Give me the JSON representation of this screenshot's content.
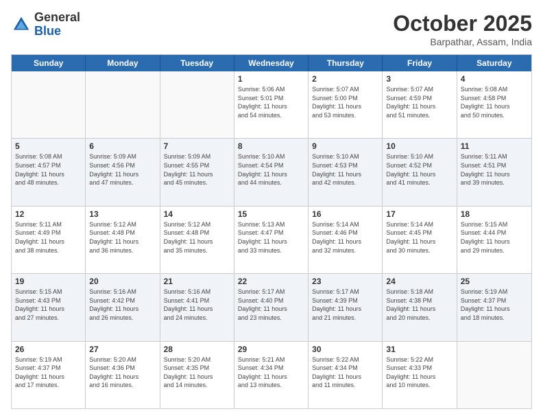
{
  "header": {
    "logo_general": "General",
    "logo_blue": "Blue",
    "month": "October 2025",
    "location": "Barpathar, Assam, India"
  },
  "weekdays": [
    "Sunday",
    "Monday",
    "Tuesday",
    "Wednesday",
    "Thursday",
    "Friday",
    "Saturday"
  ],
  "rows": [
    {
      "alt": false,
      "cells": [
        {
          "day": "",
          "info": ""
        },
        {
          "day": "",
          "info": ""
        },
        {
          "day": "",
          "info": ""
        },
        {
          "day": "1",
          "info": "Sunrise: 5:06 AM\nSunset: 5:01 PM\nDaylight: 11 hours\nand 54 minutes."
        },
        {
          "day": "2",
          "info": "Sunrise: 5:07 AM\nSunset: 5:00 PM\nDaylight: 11 hours\nand 53 minutes."
        },
        {
          "day": "3",
          "info": "Sunrise: 5:07 AM\nSunset: 4:59 PM\nDaylight: 11 hours\nand 51 minutes."
        },
        {
          "day": "4",
          "info": "Sunrise: 5:08 AM\nSunset: 4:58 PM\nDaylight: 11 hours\nand 50 minutes."
        }
      ]
    },
    {
      "alt": true,
      "cells": [
        {
          "day": "5",
          "info": "Sunrise: 5:08 AM\nSunset: 4:57 PM\nDaylight: 11 hours\nand 48 minutes."
        },
        {
          "day": "6",
          "info": "Sunrise: 5:09 AM\nSunset: 4:56 PM\nDaylight: 11 hours\nand 47 minutes."
        },
        {
          "day": "7",
          "info": "Sunrise: 5:09 AM\nSunset: 4:55 PM\nDaylight: 11 hours\nand 45 minutes."
        },
        {
          "day": "8",
          "info": "Sunrise: 5:10 AM\nSunset: 4:54 PM\nDaylight: 11 hours\nand 44 minutes."
        },
        {
          "day": "9",
          "info": "Sunrise: 5:10 AM\nSunset: 4:53 PM\nDaylight: 11 hours\nand 42 minutes."
        },
        {
          "day": "10",
          "info": "Sunrise: 5:10 AM\nSunset: 4:52 PM\nDaylight: 11 hours\nand 41 minutes."
        },
        {
          "day": "11",
          "info": "Sunrise: 5:11 AM\nSunset: 4:51 PM\nDaylight: 11 hours\nand 39 minutes."
        }
      ]
    },
    {
      "alt": false,
      "cells": [
        {
          "day": "12",
          "info": "Sunrise: 5:11 AM\nSunset: 4:49 PM\nDaylight: 11 hours\nand 38 minutes."
        },
        {
          "day": "13",
          "info": "Sunrise: 5:12 AM\nSunset: 4:48 PM\nDaylight: 11 hours\nand 36 minutes."
        },
        {
          "day": "14",
          "info": "Sunrise: 5:12 AM\nSunset: 4:48 PM\nDaylight: 11 hours\nand 35 minutes."
        },
        {
          "day": "15",
          "info": "Sunrise: 5:13 AM\nSunset: 4:47 PM\nDaylight: 11 hours\nand 33 minutes."
        },
        {
          "day": "16",
          "info": "Sunrise: 5:14 AM\nSunset: 4:46 PM\nDaylight: 11 hours\nand 32 minutes."
        },
        {
          "day": "17",
          "info": "Sunrise: 5:14 AM\nSunset: 4:45 PM\nDaylight: 11 hours\nand 30 minutes."
        },
        {
          "day": "18",
          "info": "Sunrise: 5:15 AM\nSunset: 4:44 PM\nDaylight: 11 hours\nand 29 minutes."
        }
      ]
    },
    {
      "alt": true,
      "cells": [
        {
          "day": "19",
          "info": "Sunrise: 5:15 AM\nSunset: 4:43 PM\nDaylight: 11 hours\nand 27 minutes."
        },
        {
          "day": "20",
          "info": "Sunrise: 5:16 AM\nSunset: 4:42 PM\nDaylight: 11 hours\nand 26 minutes."
        },
        {
          "day": "21",
          "info": "Sunrise: 5:16 AM\nSunset: 4:41 PM\nDaylight: 11 hours\nand 24 minutes."
        },
        {
          "day": "22",
          "info": "Sunrise: 5:17 AM\nSunset: 4:40 PM\nDaylight: 11 hours\nand 23 minutes."
        },
        {
          "day": "23",
          "info": "Sunrise: 5:17 AM\nSunset: 4:39 PM\nDaylight: 11 hours\nand 21 minutes."
        },
        {
          "day": "24",
          "info": "Sunrise: 5:18 AM\nSunset: 4:38 PM\nDaylight: 11 hours\nand 20 minutes."
        },
        {
          "day": "25",
          "info": "Sunrise: 5:19 AM\nSunset: 4:37 PM\nDaylight: 11 hours\nand 18 minutes."
        }
      ]
    },
    {
      "alt": false,
      "cells": [
        {
          "day": "26",
          "info": "Sunrise: 5:19 AM\nSunset: 4:37 PM\nDaylight: 11 hours\nand 17 minutes."
        },
        {
          "day": "27",
          "info": "Sunrise: 5:20 AM\nSunset: 4:36 PM\nDaylight: 11 hours\nand 16 minutes."
        },
        {
          "day": "28",
          "info": "Sunrise: 5:20 AM\nSunset: 4:35 PM\nDaylight: 11 hours\nand 14 minutes."
        },
        {
          "day": "29",
          "info": "Sunrise: 5:21 AM\nSunset: 4:34 PM\nDaylight: 11 hours\nand 13 minutes."
        },
        {
          "day": "30",
          "info": "Sunrise: 5:22 AM\nSunset: 4:34 PM\nDaylight: 11 hours\nand 11 minutes."
        },
        {
          "day": "31",
          "info": "Sunrise: 5:22 AM\nSunset: 4:33 PM\nDaylight: 11 hours\nand 10 minutes."
        },
        {
          "day": "",
          "info": ""
        }
      ]
    }
  ]
}
